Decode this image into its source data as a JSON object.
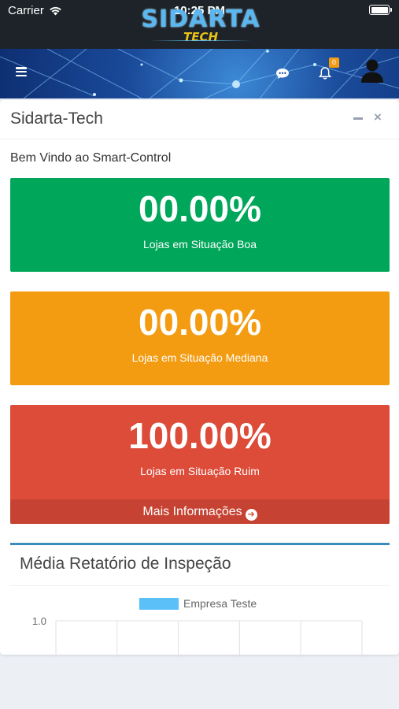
{
  "status_bar": {
    "carrier": "Carrier",
    "time": "10:25 PM"
  },
  "logo": {
    "main": "SIDARTA",
    "sub": "TECH"
  },
  "header": {
    "notification_count": "0"
  },
  "panel": {
    "title": "Sidarta-Tech",
    "welcome": "Bem Vindo ao Smart-Control"
  },
  "stats": [
    {
      "value": "00.00%",
      "label": "Lojas em Situação Boa",
      "color": "#00a65a"
    },
    {
      "value": "00.00%",
      "label": "Lojas em Situação Mediana",
      "color": "#f39c12"
    },
    {
      "value": "100.00%",
      "label": "Lojas em Situação Ruim",
      "color": "#dd4b39",
      "more_info": "Mais Informações"
    }
  ],
  "chart_box": {
    "title": "Média Retatório de Inspeção"
  },
  "chart_data": {
    "type": "bar",
    "title": "",
    "series": [
      {
        "name": "Empresa Teste",
        "color": "#5bc0f8",
        "values": []
      }
    ],
    "yticks": [
      "1.0"
    ],
    "grid": true,
    "legend": "top"
  }
}
